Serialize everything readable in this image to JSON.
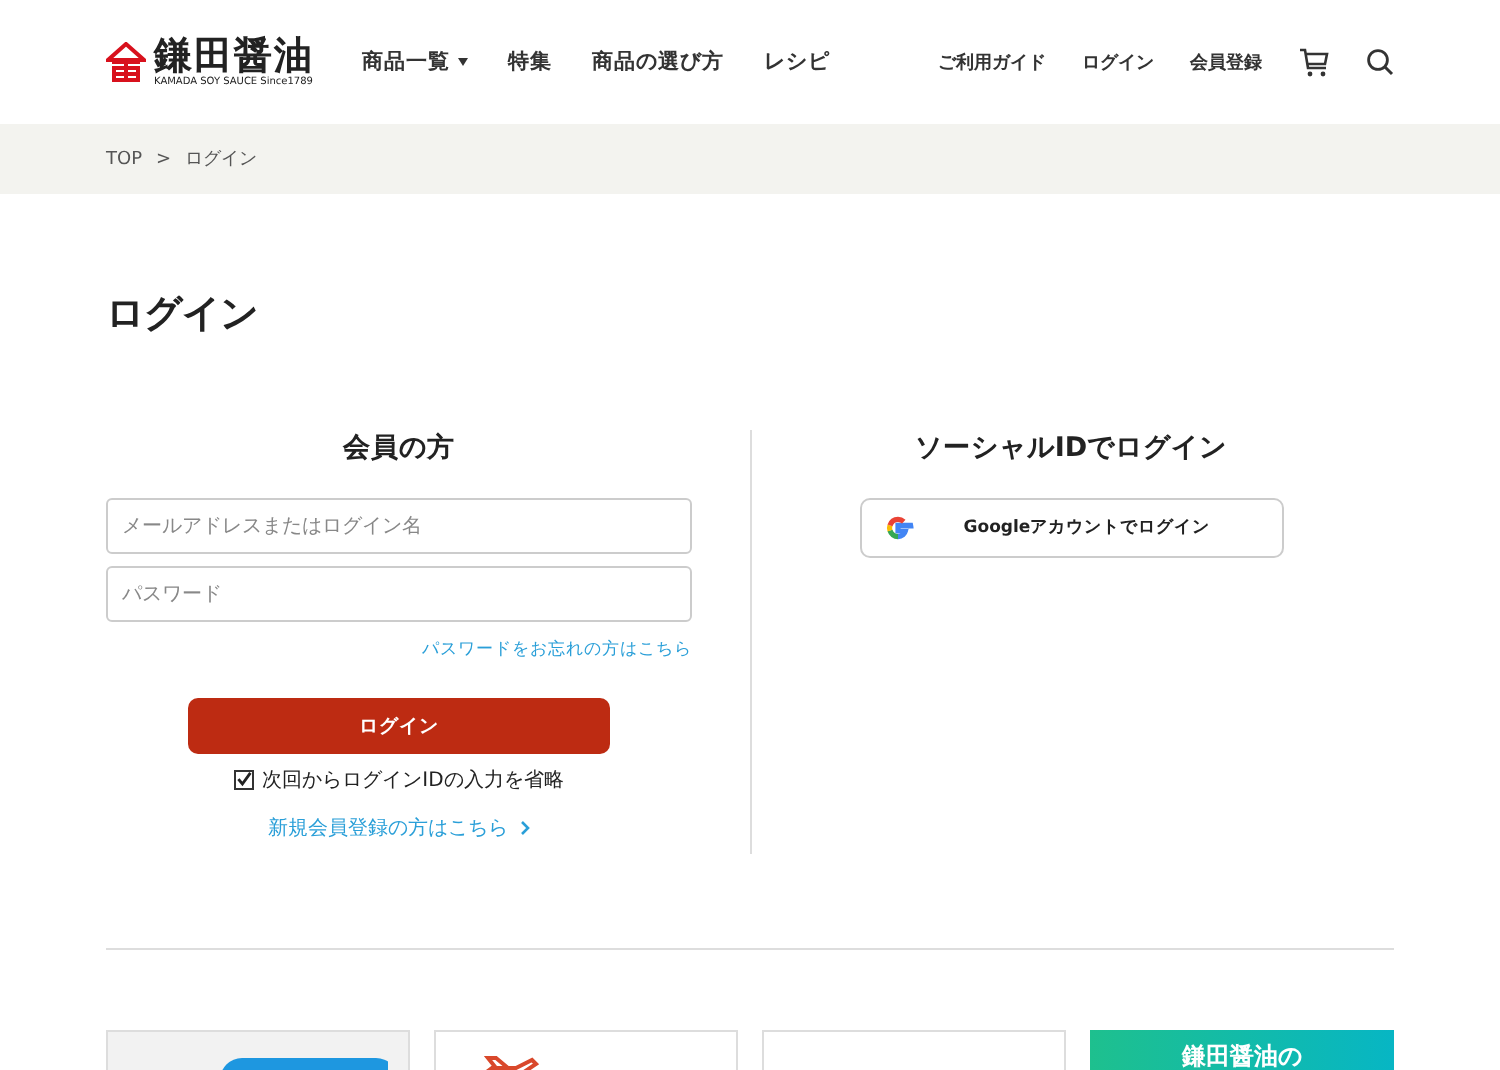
{
  "header": {
    "logo": {
      "name": "鎌田醤油",
      "tagline": "KAMADA SOY SAUCE Since1789"
    },
    "nav": [
      {
        "label": "商品一覧",
        "dropdown": true
      },
      {
        "label": "特集",
        "dropdown": false
      },
      {
        "label": "商品の選び方",
        "dropdown": false
      },
      {
        "label": "レシピ",
        "dropdown": false
      }
    ],
    "utility": [
      "ご利用ガイド",
      "ログイン",
      "会員登録"
    ]
  },
  "breadcrumb": [
    "TOP",
    ">",
    "ログイン"
  ],
  "page_title": "ログイン",
  "member": {
    "heading": "会員の方",
    "email_placeholder": "メールアドレスまたはログイン名",
    "password_placeholder": "パスワード",
    "forgot_link": "パスワードをお忘れの方はこちら",
    "login_button": "ログイン",
    "remember": {
      "label": "次回からログインIDの入力を省略",
      "checked": true
    },
    "register_link": "新規会員登録の方はこちら"
  },
  "social": {
    "heading": "ソーシャルIDでログイン",
    "google_button": "Googleアカウントでログイン"
  },
  "banners": [
    {
      "kind": "catalog"
    },
    {
      "kind": "plane"
    },
    {
      "kind": "blank"
    },
    {
      "kind": "teal",
      "text": "鎌田醤油の"
    }
  ]
}
